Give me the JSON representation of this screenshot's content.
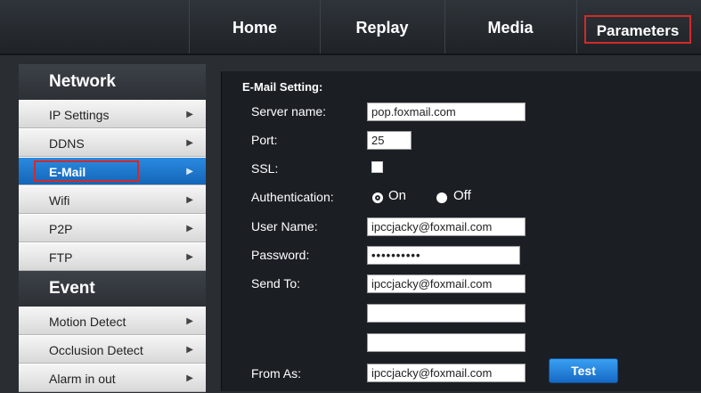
{
  "nav": {
    "items": [
      "Home",
      "Replay",
      "Media",
      "Parameters"
    ],
    "active": "Parameters"
  },
  "sidebar": {
    "sections": [
      {
        "title": "Network",
        "items": [
          "IP Settings",
          "DDNS",
          "E-Mail",
          "Wifi",
          "P2P",
          "FTP"
        ]
      },
      {
        "title": "Event",
        "items": [
          "Motion Detect",
          "Occlusion Detect",
          "Alarm in out"
        ]
      }
    ],
    "active_item": "E-Mail"
  },
  "email_form": {
    "title": "E-Mail Setting:",
    "server_name_label": "Server name:",
    "server_name_value": "pop.foxmail.com",
    "port_label": "Port:",
    "port_value": "25",
    "ssl_label": "SSL:",
    "ssl_checked": false,
    "auth_label": "Authentication:",
    "auth_on_label": "On",
    "auth_off_label": "Off",
    "auth_selected": "On",
    "username_label": "User Name:",
    "username_value": "ipccjacky@foxmail.com",
    "password_label": "Password:",
    "password_value": "••••••••••",
    "send_to_label": "Send To:",
    "send_to_values": [
      "ipccjacky@foxmail.com",
      "",
      ""
    ],
    "from_as_label": "From As:",
    "from_as_value": "ipccjacky@foxmail.com",
    "test_button_label": "Test"
  },
  "colors": {
    "active_item": "#1e7bd4",
    "highlight_border": "#d22a2a",
    "panel_bg": "#1b1f24",
    "topbar_bg": "#2a2e33"
  }
}
